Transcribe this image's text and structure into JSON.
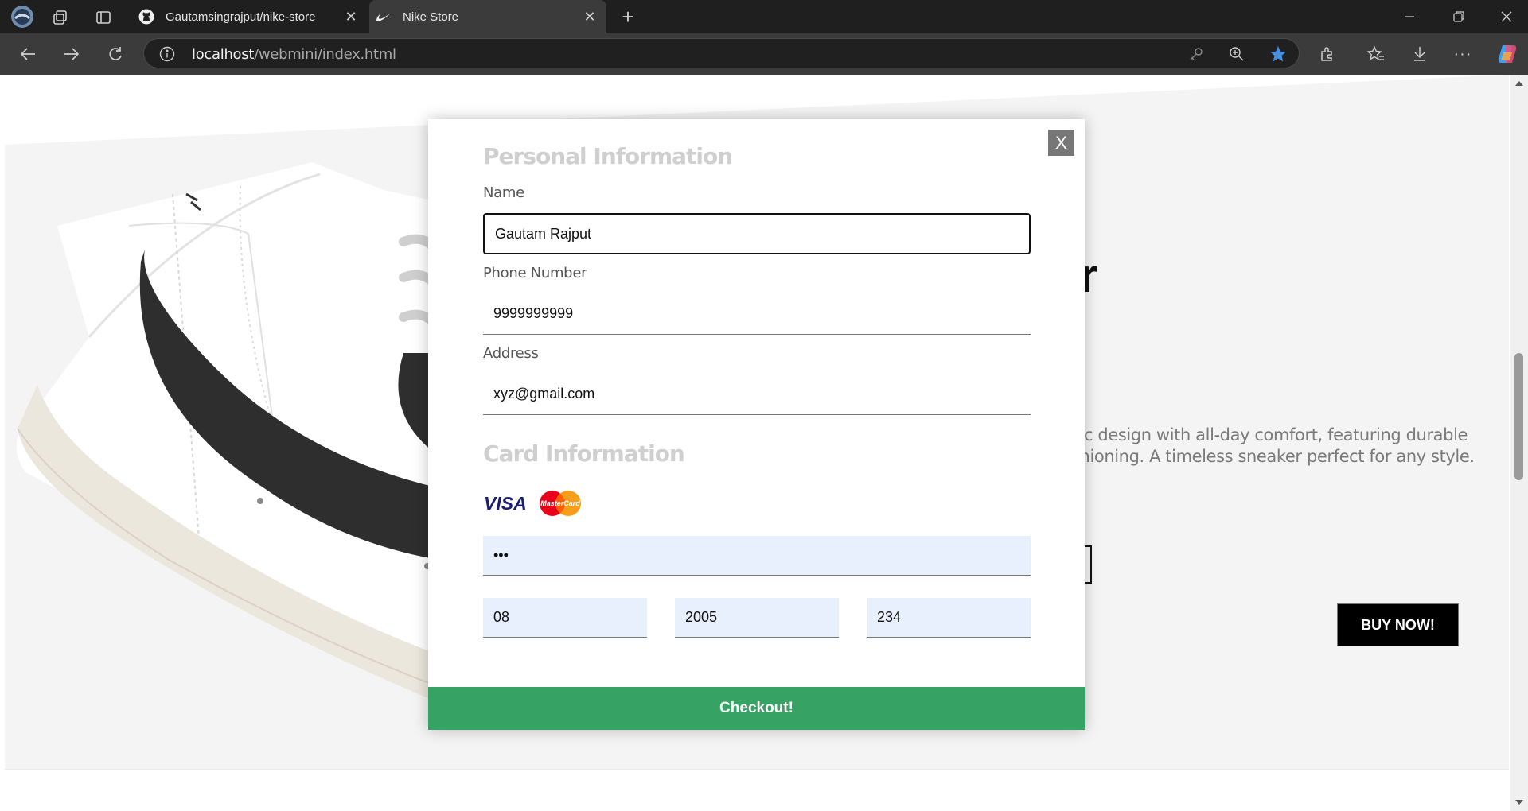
{
  "browser": {
    "tabs": [
      {
        "title": "Gautamsingrajput/nike-store",
        "icon": "github-icon",
        "active": false
      },
      {
        "title": "Nike Store",
        "icon": "nike-swoosh-icon",
        "active": true
      }
    ],
    "new_tab_label": "+",
    "url_host": "localhost",
    "url_path": "/webmini/index.html"
  },
  "hero": {
    "description_line1": "sic design with all-day comfort, featuring durable",
    "description_line2": "shioning. A timeless sneaker perfect for any style.",
    "heading_fragment": "r",
    "buy_button": "BUY NOW!"
  },
  "modal": {
    "close_label": "X",
    "personal_title": "Personal Information",
    "name_label": "Name",
    "name_value": "Gautam Rajput",
    "phone_label": "Phone Number",
    "phone_value": "9999999999",
    "address_label": "Address",
    "address_value": "xyz@gmail.com",
    "card_title": "Card Information",
    "card_logos": [
      "VISA",
      "MasterCard"
    ],
    "card_number_value": "•••",
    "exp_month_value": "08",
    "exp_year_value": "2005",
    "cvv_value": "234",
    "checkout_label": "Checkout!"
  },
  "colors": {
    "checkout": "#36a264",
    "autofill": "#e8f0fe",
    "favorite_star": "#4a90e2"
  }
}
